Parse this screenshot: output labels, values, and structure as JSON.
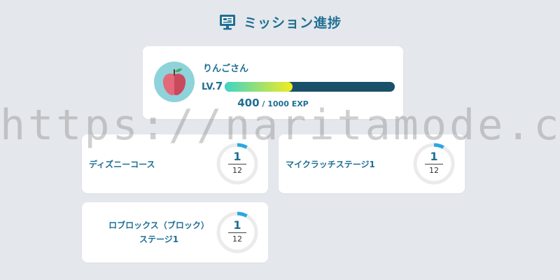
{
  "header": {
    "title": "ミッション進捗",
    "icon": "monitor-icon"
  },
  "profile": {
    "username": "りんごさん",
    "level_prefix": "LV.",
    "level": "7",
    "exp_current": "400",
    "exp_sep": " / ",
    "exp_max": "1000",
    "exp_unit": " EXP",
    "progress_fraction": 0.4,
    "avatar_icon": "apple-icon"
  },
  "missions": [
    {
      "name": "ディズニーコース",
      "done": "1",
      "total": "12",
      "fraction": 0.083
    },
    {
      "name": "マイクラッチステージ1",
      "done": "1",
      "total": "12",
      "fraction": 0.083
    },
    {
      "name_line1": "ロブロックス（ブロック）",
      "name_line2": "ステージ1",
      "done": "1",
      "total": "12",
      "fraction": 0.083
    }
  ],
  "watermark": "https://naritamode.com/",
  "colors": {
    "accent": "#1f6f93",
    "ring": "#2aa7e0",
    "track": "#ebebeb",
    "bar_bg": "#1a5068"
  }
}
